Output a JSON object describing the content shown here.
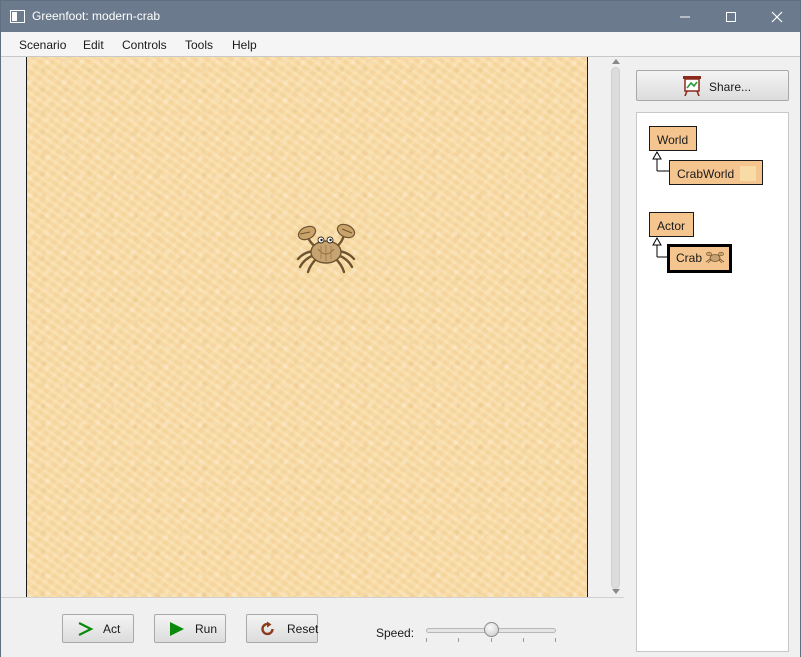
{
  "window": {
    "title": "Greenfoot: modern-crab",
    "icon": "greenfoot-app-icon"
  },
  "menu": {
    "items": [
      "Scenario",
      "Edit",
      "Controls",
      "Tools",
      "Help"
    ]
  },
  "world": {
    "background": "sand-texture",
    "actors": [
      {
        "class": "Crab",
        "icon": "crab-image"
      }
    ]
  },
  "controls": {
    "act_label": "Act",
    "run_label": "Run",
    "reset_label": "Reset",
    "speed_label": "Speed:",
    "speed_fraction": 0.5
  },
  "side": {
    "share_label": "Share...",
    "classes": {
      "world": "World",
      "crabworld": "CrabWorld",
      "actor": "Actor",
      "crab": "Crab"
    }
  },
  "colors": {
    "titlebar": "#6b7a8c",
    "class_box": "#f5c590",
    "sand": "#f8dba5",
    "run_green": "#0a8a0a"
  }
}
